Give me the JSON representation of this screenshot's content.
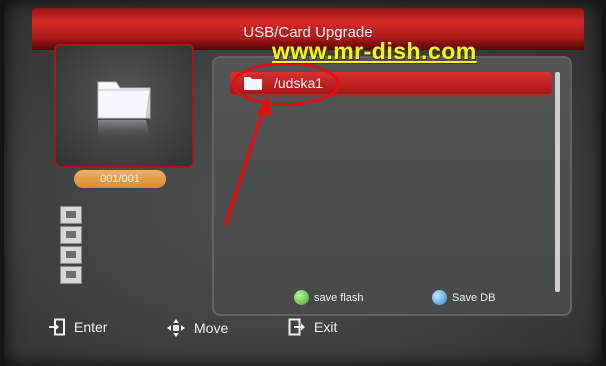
{
  "header": {
    "title": "USB/Card Upgrade",
    "watermark": "www.mr-dish.com"
  },
  "preview": {
    "icon": "folder-icon",
    "counter": "001/001"
  },
  "side_icons": [
    "usb-drive-icon",
    "user-icon",
    "printer-icon",
    "network-icon"
  ],
  "file_list": {
    "items": [
      {
        "label": "/udska1",
        "icon": "folder-icon",
        "selected": true
      }
    ]
  },
  "color_keys": {
    "green_label": "save flash",
    "blue_label": "Save DB"
  },
  "nav": {
    "enter_label": "Enter",
    "move_label": "Move",
    "exit_label": "Exit"
  },
  "colors": {
    "accent_red": "#c81e1e",
    "counter_orange": "#e29a44",
    "watermark_yellow": "#f5f518"
  }
}
